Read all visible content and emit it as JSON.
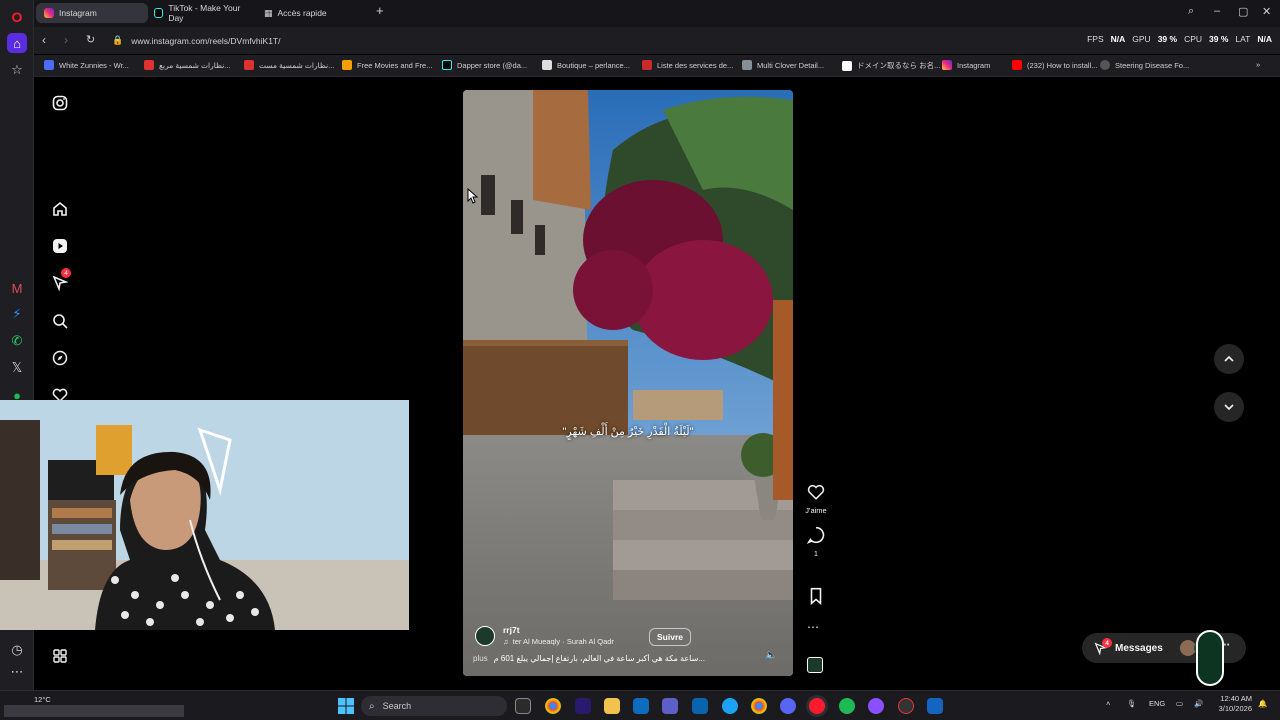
{
  "browser": {
    "tabs": [
      {
        "label": "Instagram",
        "active": true
      },
      {
        "label": "TikTok - Make Your Day",
        "active": false
      },
      {
        "label": "Accès rapide",
        "active": false
      }
    ],
    "url": "www.instagram.com/reels/DVmfvhiK1T/",
    "stats": {
      "fps_label": "FPS",
      "fps_value": "N/A",
      "gpu_label": "GPU",
      "gpu_value": "39 %",
      "cpu_label": "CPU",
      "cpu_value": "39 %",
      "lat_label": "LAT",
      "lat_value": "N/A"
    },
    "bookmarks": [
      "White Zunnies - Wr...",
      "نظارات شمسية مربع...",
      "نظارات شمسية مست...",
      "Free Movies and Fre...",
      "Dapper store (@da...",
      "Boutique – perlance...",
      "Liste des services de...",
      "Multi Clover Detail...",
      "ドメイン取るなら お名...",
      "Instagram",
      "(232) How to install...",
      "Steering Disease Fo..."
    ]
  },
  "instagram": {
    "nav_badge": "4",
    "reel": {
      "overlay_text": "\"لَيْلَةُ الْقَدْرِ خَيْرٌ مِنْ أَلْفِ شَهْرٍ\"",
      "username": "rrj7t",
      "audio": "ter Al Mueaqly · Surah Al Qadr",
      "follow": "Suivre",
      "caption": "ساعة مكة هي أكبر ساعة في العالم، بارتفاع إجمالي يبلغ 601 م...",
      "more": "plus"
    },
    "actions": {
      "like_label": "J'aime",
      "comment_count": "1"
    },
    "messages": {
      "label": "Messages",
      "badge": "4"
    }
  },
  "taskbar": {
    "weather": "12°C",
    "search_placeholder": "Search",
    "lang": "ENG",
    "time": "12:40 AM",
    "date": "3/10/2026"
  }
}
